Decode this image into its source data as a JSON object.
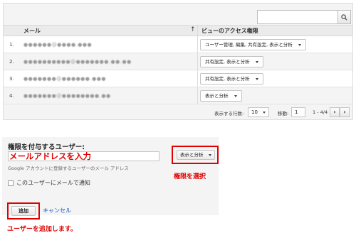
{
  "search": {
    "value": "",
    "placeholder": "",
    "icon": "search-icon"
  },
  "table": {
    "columns": {
      "email": "メール",
      "sort_arrow": "↑",
      "permissions": "ビューのアクセス権限"
    },
    "rows": [
      {
        "num": "1.",
        "email": "●●●●●●@●●●●.●●●",
        "permission": "ユーザー管理, 編集, 共有設定, 表示と分析"
      },
      {
        "num": "2.",
        "email": "●●●●●●●●●●@●●●●●●●.●●.●●",
        "permission": "共有設定, 表示と分析"
      },
      {
        "num": "3.",
        "email": "●●●●●●●@●●●●●●.●●●",
        "permission": "共有設定, 表示と分析"
      },
      {
        "num": "4.",
        "email": "●●●●●●●@●●●●●●●●.●●",
        "permission": "表示と分析"
      }
    ]
  },
  "pager": {
    "rows_label": "表示する行数:",
    "rows_value": "10",
    "goto_label": "移動:",
    "goto_value": "1",
    "range": "1 - 4/4",
    "prev": "‹",
    "next": "›"
  },
  "form": {
    "title": "権限を付与するユーザー:",
    "email_value": "",
    "email_callout": "メールアドレスを入力",
    "hint": "Google アカウントに登録するユーザーのメール アドレス",
    "permission_value": "表示と分析",
    "permission_callout": "権限を選択",
    "notify_label": "このユーザーにメールで通知",
    "add_label": "追加",
    "cancel_label": "キャンセル",
    "add_callout": "ユーザーを追加します。"
  },
  "colors": {
    "callout_red": "#e00000",
    "link_blue": "#1155cc",
    "panel_bg": "#f4f4f4"
  }
}
